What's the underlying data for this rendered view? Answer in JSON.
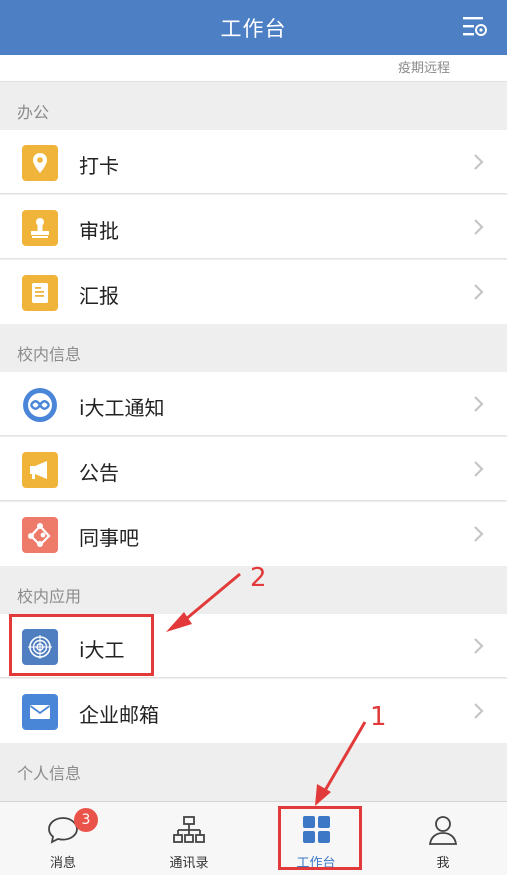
{
  "header": {
    "title": "工作台",
    "settings_icon": "settings-list-icon"
  },
  "subrow": {
    "remote_label": "疫期远程"
  },
  "sections": [
    {
      "title": "办公",
      "items": [
        {
          "label": "打卡",
          "icon": "location-pin-icon",
          "color": "#f0b43a"
        },
        {
          "label": "审批",
          "icon": "stamp-icon",
          "color": "#f0b43a"
        },
        {
          "label": "汇报",
          "icon": "document-icon",
          "color": "#f0b43a"
        }
      ]
    },
    {
      "title": "校内信息",
      "items": [
        {
          "label": "i大工通知",
          "icon": "notification-logo-icon",
          "color": "#4a86d8"
        },
        {
          "label": "公告",
          "icon": "megaphone-icon",
          "color": "#f0b43a"
        },
        {
          "label": "同事吧",
          "icon": "network-icon",
          "color": "#ee7a6a"
        }
      ]
    },
    {
      "title": "校内应用",
      "items": [
        {
          "label": "i大工",
          "icon": "target-logo-icon",
          "color": "#4f7fc1"
        },
        {
          "label": "企业邮箱",
          "icon": "mail-icon",
          "color": "#4a86d8"
        }
      ]
    },
    {
      "title": "个人信息",
      "items": []
    }
  ],
  "tabbar": {
    "tabs": [
      {
        "label": "消息",
        "icon": "chat-bubble-icon",
        "badge": "3"
      },
      {
        "label": "通讯录",
        "icon": "org-chart-icon"
      },
      {
        "label": "工作台",
        "icon": "grid-icon",
        "active": true
      },
      {
        "label": "我",
        "icon": "person-icon"
      }
    ]
  },
  "annotations": {
    "marker_1": "1",
    "marker_2": "2",
    "color": "#e23a3a"
  }
}
